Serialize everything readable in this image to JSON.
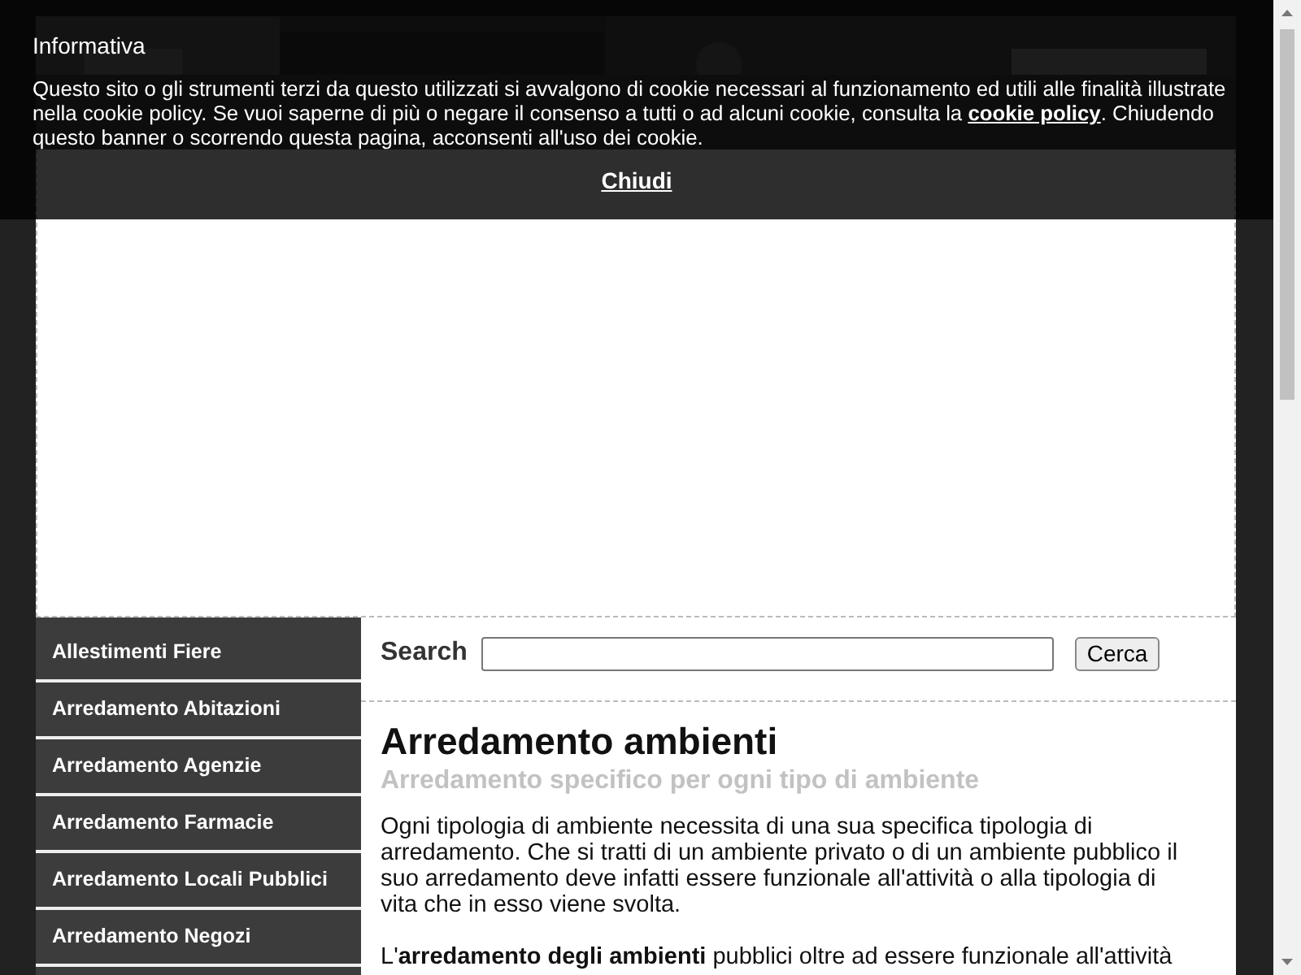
{
  "cookie_banner": {
    "title": "Informativa",
    "text_before": "Questo sito o gli strumenti terzi da questo utilizzati si avvalgono di cookie necessari al funzionamento ed utili alle finalità illustrate nella cookie policy. Se vuoi saperne di più o negare il consenso a tutti o ad alcuni cookie, consulta la ",
    "link": "cookie policy",
    "text_after": ". Chiudendo questo banner o scorrendo questa pagina, acconsenti all'uso dei cookie.",
    "close": "Chiudi"
  },
  "sidebar": {
    "items": [
      {
        "label": "Allestimenti Fiere"
      },
      {
        "label": "Arredamento Abitazioni"
      },
      {
        "label": "Arredamento Agenzie"
      },
      {
        "label": "Arredamento Farmacie"
      },
      {
        "label": "Arredamento Locali Pubblici"
      },
      {
        "label": "Arredamento Negozi"
      }
    ]
  },
  "search": {
    "label": "Search",
    "button": "Cerca"
  },
  "article": {
    "title": "Arredamento ambienti",
    "subtitle": "Arredamento specifico per ogni tipo di ambiente",
    "paragraphs": [
      "Ogni tipologia di ambiente necessita di una sua specifica tipologia di arredamento. Che si tratti di un ambiente privato o di un ambiente pubblico il suo arredamento deve infatti essere funzionale all'attività o alla tipologia di vita che in esso viene svolta.",
      "L'**arredamento degli ambienti** pubblici oltre ad essere funzionale all'attività"
    ]
  }
}
